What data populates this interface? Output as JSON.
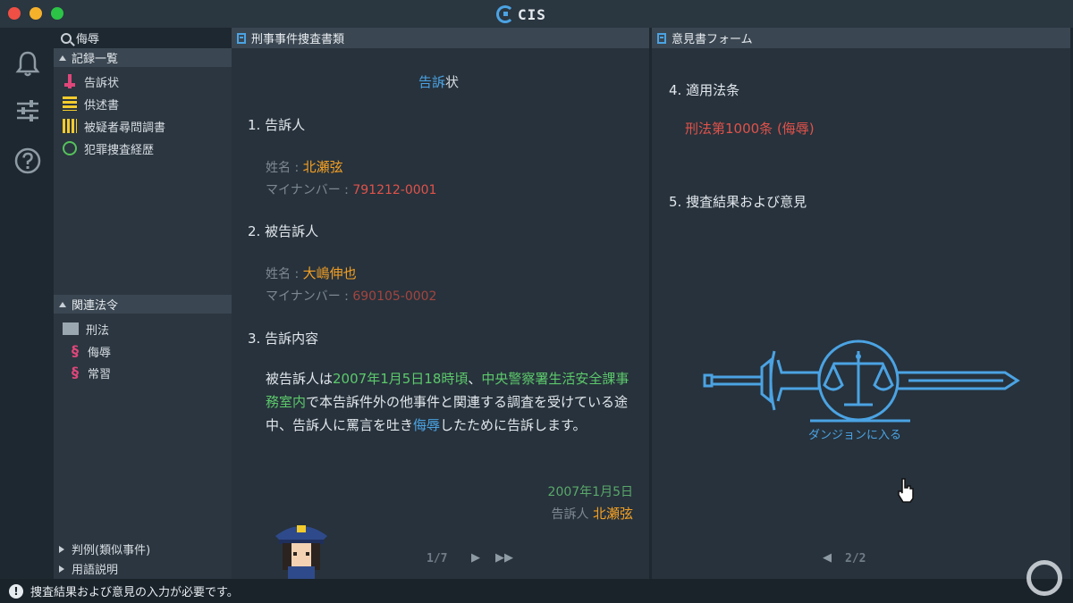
{
  "window": {
    "title": "CIS"
  },
  "rail": {
    "icons": [
      "bell-icon",
      "sliders-icon",
      "help-icon"
    ]
  },
  "nav": {
    "search_value": "侮辱",
    "records_header": "記録一覧",
    "records": [
      {
        "label": "告訴状",
        "icon": "complaint-icon"
      },
      {
        "label": "供述書",
        "icon": "statement-icon"
      },
      {
        "label": "被疑者尋問調書",
        "icon": "interrogation-icon"
      },
      {
        "label": "犯罪捜査経歴",
        "icon": "history-icon"
      }
    ],
    "laws_header": "関連法令",
    "law_folder": "刑法",
    "laws": [
      "侮辱",
      "常習"
    ],
    "footer": [
      "判例(類似事件)",
      "用語説明"
    ]
  },
  "middle": {
    "header": "刑事事件捜査書類",
    "doc_title_a": "告訴",
    "doc_title_b": "状",
    "sec1": "1. 告訴人",
    "name_label": "姓名 : ",
    "mynumber_label": "マイナンバー : ",
    "complainant_name": "北瀬弦",
    "complainant_number": "791212-0001",
    "sec2": "2. 被告訴人",
    "accused_name": "大嶋伸也",
    "accused_number": "690105-0002",
    "sec3": "3. 告訴内容",
    "content_1": "被告訴人は",
    "content_2": "2007年1月5日18時頃",
    "content_3": "、",
    "content_4": "中央警察署生活安全課事務室内",
    "content_5": "で本告訴件外の他事件と関連する調査を受けている途中、告訴人に罵言を吐き",
    "content_6": "侮辱",
    "content_7": "したために告訴します。",
    "date": "2007年1月5日",
    "signer_label": "告訴人",
    "signer_name": "北瀬弦",
    "pager": "1/7"
  },
  "right": {
    "header": "意見書フォーム",
    "sec4": "4. 適用法条",
    "law_applied": "刑法第1000条 (侮辱)",
    "sec5": "5. 捜査結果および意見",
    "dungeon_label": "ダンジョンに入る",
    "pager": "2/2"
  },
  "status": {
    "message": "捜査結果および意見の入力が必要です。"
  },
  "colors": {
    "accent": "#4ba3e3",
    "orange": "#f4a024",
    "red": "#e0524a",
    "green": "#5cc96b"
  }
}
